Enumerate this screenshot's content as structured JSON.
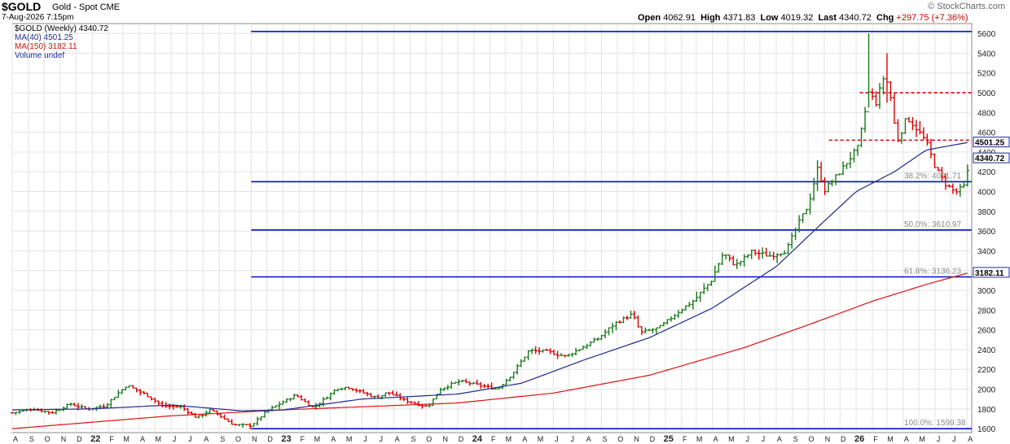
{
  "header": {
    "symbol": "$GOLD",
    "description": "Gold - Spot CME",
    "date": "7-Aug-2026 7:15pm",
    "open_label": "Open",
    "open": "4062.91",
    "high_label": "High",
    "high": "4371.83",
    "low_label": "Low",
    "low": "4019.32",
    "last_label": "Last",
    "last": "4340.72",
    "chg_label": "Chg",
    "chg": "+297.75 (+7.36%)",
    "brand": "© StockCharts.com"
  },
  "legend": {
    "symbol_entry": "$GOLD (Weekly) 4340.72",
    "ma40_entry": "MA(40) 4501.25",
    "ma150_entry": "MA(150) 3182.11",
    "volume_entry": "Volume undef"
  },
  "colors": {
    "up_bar": "#1a7a1a",
    "down_bar": "#dd0000",
    "ma40": "#1f2a8c",
    "ma150": "#dd1111",
    "fib": "#0010c8",
    "resistance": "#dd0000",
    "grid": "#e3e3e3",
    "label_box": "#1f2a8c"
  },
  "chart_data": {
    "type": "ohlc",
    "period": "weekly",
    "ylim": [
      1560,
      5700
    ],
    "y_ticks": [
      1600,
      1800,
      2000,
      2200,
      2400,
      2600,
      2800,
      3000,
      3200,
      3400,
      3600,
      3800,
      4000,
      4200,
      4400,
      4600,
      4800,
      5000,
      5200,
      5400,
      5600
    ],
    "x_range": [
      "2021-08-01",
      "2026-08-10"
    ],
    "x_ticks": [
      {
        "date": "2021-08-01",
        "label": "A"
      },
      {
        "date": "2021-09-01",
        "label": "S"
      },
      {
        "date": "2021-10-01",
        "label": "O"
      },
      {
        "date": "2021-11-01",
        "label": "N"
      },
      {
        "date": "2021-12-01",
        "label": "D"
      },
      {
        "date": "2022-01-01",
        "label": "22"
      },
      {
        "date": "2022-02-01",
        "label": "F"
      },
      {
        "date": "2022-03-01",
        "label": "M"
      },
      {
        "date": "2022-04-01",
        "label": "A"
      },
      {
        "date": "2022-05-01",
        "label": "M"
      },
      {
        "date": "2022-06-01",
        "label": "J"
      },
      {
        "date": "2022-07-01",
        "label": "J"
      },
      {
        "date": "2022-08-01",
        "label": "A"
      },
      {
        "date": "2022-09-01",
        "label": "S"
      },
      {
        "date": "2022-10-01",
        "label": "O"
      },
      {
        "date": "2022-11-01",
        "label": "N"
      },
      {
        "date": "2022-12-01",
        "label": "D"
      },
      {
        "date": "2023-01-01",
        "label": "23"
      },
      {
        "date": "2023-02-01",
        "label": "F"
      },
      {
        "date": "2023-03-01",
        "label": "M"
      },
      {
        "date": "2023-04-01",
        "label": "A"
      },
      {
        "date": "2023-05-01",
        "label": "M"
      },
      {
        "date": "2023-06-01",
        "label": "J"
      },
      {
        "date": "2023-07-01",
        "label": "J"
      },
      {
        "date": "2023-08-01",
        "label": "A"
      },
      {
        "date": "2023-09-01",
        "label": "S"
      },
      {
        "date": "2023-10-01",
        "label": "O"
      },
      {
        "date": "2023-11-01",
        "label": "N"
      },
      {
        "date": "2023-12-01",
        "label": "D"
      },
      {
        "date": "2024-01-01",
        "label": "24"
      },
      {
        "date": "2024-02-01",
        "label": "F"
      },
      {
        "date": "2024-03-01",
        "label": "M"
      },
      {
        "date": "2024-04-01",
        "label": "A"
      },
      {
        "date": "2024-05-01",
        "label": "M"
      },
      {
        "date": "2024-06-01",
        "label": "J"
      },
      {
        "date": "2024-07-01",
        "label": "J"
      },
      {
        "date": "2024-08-01",
        "label": "A"
      },
      {
        "date": "2024-09-01",
        "label": "S"
      },
      {
        "date": "2024-10-01",
        "label": "O"
      },
      {
        "date": "2024-11-01",
        "label": "N"
      },
      {
        "date": "2024-12-01",
        "label": "D"
      },
      {
        "date": "2025-01-01",
        "label": "25"
      },
      {
        "date": "2025-02-01",
        "label": "F"
      },
      {
        "date": "2025-03-01",
        "label": "M"
      },
      {
        "date": "2025-04-01",
        "label": "A"
      },
      {
        "date": "2025-05-01",
        "label": "M"
      },
      {
        "date": "2025-06-01",
        "label": "J"
      },
      {
        "date": "2025-07-01",
        "label": "J"
      },
      {
        "date": "2025-08-01",
        "label": "A"
      },
      {
        "date": "2025-09-01",
        "label": "S"
      },
      {
        "date": "2025-10-01",
        "label": "O"
      },
      {
        "date": "2025-11-01",
        "label": "N"
      },
      {
        "date": "2025-12-01",
        "label": "D"
      },
      {
        "date": "2026-01-01",
        "label": "26"
      },
      {
        "date": "2026-02-01",
        "label": "F"
      },
      {
        "date": "2026-03-01",
        "label": "M"
      },
      {
        "date": "2026-04-01",
        "label": "A"
      },
      {
        "date": "2026-05-01",
        "label": "M"
      },
      {
        "date": "2026-06-01",
        "label": "J"
      },
      {
        "date": "2026-07-01",
        "label": "J"
      },
      {
        "date": "2026-08-01",
        "label": "A"
      }
    ],
    "close_path": [
      [
        "2021-08-01",
        1760
      ],
      [
        "2021-09-10",
        1800
      ],
      [
        "2021-10-15",
        1760
      ],
      [
        "2021-11-20",
        1850
      ],
      [
        "2021-12-20",
        1800
      ],
      [
        "2022-01-25",
        1830
      ],
      [
        "2022-03-08",
        2040
      ],
      [
        "2022-04-15",
        1940
      ],
      [
        "2022-05-15",
        1830
      ],
      [
        "2022-06-20",
        1820
      ],
      [
        "2022-07-20",
        1710
      ],
      [
        "2022-08-15",
        1790
      ],
      [
        "2022-09-28",
        1640
      ],
      [
        "2022-11-01",
        1630
      ],
      [
        "2022-12-01",
        1780
      ],
      [
        "2023-01-25",
        1940
      ],
      [
        "2023-02-28",
        1810
      ],
      [
        "2023-04-15",
        2010
      ],
      [
        "2023-05-05",
        2020
      ],
      [
        "2023-06-30",
        1910
      ],
      [
        "2023-07-20",
        1970
      ],
      [
        "2023-08-20",
        1890
      ],
      [
        "2023-10-05",
        1820
      ],
      [
        "2023-10-28",
        2000
      ],
      [
        "2023-12-04",
        2080
      ],
      [
        "2024-01-20",
        2030
      ],
      [
        "2024-02-15",
        2000
      ],
      [
        "2024-03-15",
        2160
      ],
      [
        "2024-04-15",
        2390
      ],
      [
        "2024-05-20",
        2380
      ],
      [
        "2024-06-25",
        2330
      ],
      [
        "2024-07-25",
        2420
      ],
      [
        "2024-08-25",
        2510
      ],
      [
        "2024-09-25",
        2660
      ],
      [
        "2024-10-30",
        2760
      ],
      [
        "2024-11-15",
        2570
      ],
      [
        "2024-12-20",
        2620
      ],
      [
        "2025-01-30",
        2800
      ],
      [
        "2025-02-25",
        2900
      ],
      [
        "2025-03-30",
        3100
      ],
      [
        "2025-04-22",
        3380
      ],
      [
        "2025-05-15",
        3250
      ],
      [
        "2025-06-15",
        3390
      ],
      [
        "2025-07-20",
        3350
      ],
      [
        "2025-08-20",
        3400
      ],
      [
        "2025-09-10",
        3650
      ],
      [
        "2025-10-01",
        3860
      ],
      [
        "2025-10-20",
        4250
      ],
      [
        "2025-11-01",
        4010
      ],
      [
        "2025-12-01",
        4200
      ],
      [
        "2026-01-05",
        4450
      ],
      [
        "2026-01-25",
        5000
      ],
      [
        "2026-02-08",
        4900
      ],
      [
        "2026-02-25",
        5200
      ],
      [
        "2026-03-08",
        4950
      ],
      [
        "2026-03-20",
        4500
      ],
      [
        "2026-04-08",
        4750
      ],
      [
        "2026-04-25",
        4650
      ],
      [
        "2026-05-15",
        4500
      ],
      [
        "2026-06-01",
        4250
      ],
      [
        "2026-06-20",
        4080
      ],
      [
        "2026-07-10",
        3990
      ],
      [
        "2026-07-28",
        4060
      ],
      [
        "2026-08-07",
        4340
      ]
    ],
    "extreme_bars": [
      {
        "date": "2026-01-25",
        "high": 5600,
        "low": 4850
      },
      {
        "date": "2026-02-25",
        "high": 5400,
        "low": 4900
      }
    ],
    "ma40": [
      [
        "2021-08-01",
        1790
      ],
      [
        "2022-01-01",
        1800
      ],
      [
        "2022-06-01",
        1840
      ],
      [
        "2022-10-15",
        1780
      ],
      [
        "2023-01-01",
        1790
      ],
      [
        "2023-06-01",
        1900
      ],
      [
        "2023-12-01",
        1950
      ],
      [
        "2024-04-01",
        2060
      ],
      [
        "2024-08-01",
        2300
      ],
      [
        "2024-12-01",
        2520
      ],
      [
        "2025-04-01",
        2820
      ],
      [
        "2025-08-01",
        3240
      ],
      [
        "2025-11-01",
        3700
      ],
      [
        "2026-01-01",
        4000
      ],
      [
        "2026-03-15",
        4200
      ],
      [
        "2026-05-15",
        4420
      ],
      [
        "2026-08-07",
        4501.25
      ]
    ],
    "ma150": [
      [
        "2021-08-01",
        1600
      ],
      [
        "2022-06-01",
        1730
      ],
      [
        "2023-01-01",
        1790
      ],
      [
        "2023-12-01",
        1860
      ],
      [
        "2024-06-01",
        1960
      ],
      [
        "2024-12-01",
        2140
      ],
      [
        "2025-06-01",
        2420
      ],
      [
        "2025-10-01",
        2650
      ],
      [
        "2026-02-01",
        2890
      ],
      [
        "2026-05-15",
        3060
      ],
      [
        "2026-08-07",
        3182.11
      ]
    ],
    "fib_start": "2022-11-01",
    "fib_levels": [
      {
        "price": 5620,
        "label": ""
      },
      {
        "price": 4100,
        "label": "38.2%: 4081.71"
      },
      {
        "price": 3610.97,
        "label": "50.0%: 3610.97"
      },
      {
        "price": 3136.23,
        "label": "61.8%: 3136.23"
      },
      {
        "price": 1599.38,
        "label": "100.0%: 1599.38"
      }
    ],
    "resistance_lines": [
      {
        "price": 5000,
        "from": "2026-01-08",
        "to": "2026-08-10"
      },
      {
        "price": 4520,
        "from": "2025-11-10",
        "to": "2026-08-10"
      }
    ],
    "right_labels": [
      {
        "price": 4501.25,
        "label": "4501.25"
      },
      {
        "price": 4340.72,
        "label": "4340.72"
      },
      {
        "price": 3182.11,
        "label": "3182.11"
      }
    ]
  }
}
